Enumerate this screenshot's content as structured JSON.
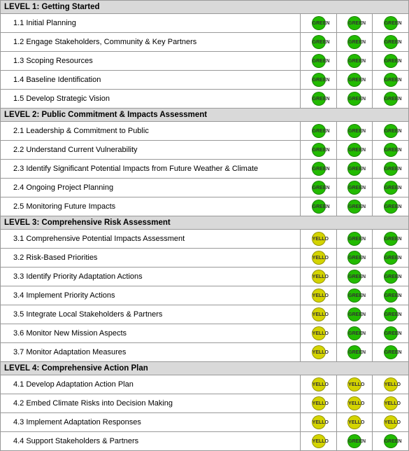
{
  "levels": [
    {
      "id": "level1",
      "header": "LEVEL 1:  Getting Started",
      "items": [
        {
          "id": "1.1",
          "label": "1.1 Initial Planning",
          "cols": [
            "green",
            "green",
            "green"
          ]
        },
        {
          "id": "1.2",
          "label": "1.2 Engage Stakeholders, Community & Key Partners",
          "cols": [
            "green",
            "green",
            "green"
          ]
        },
        {
          "id": "1.3",
          "label": "1.3 Scoping Resources",
          "cols": [
            "green",
            "green",
            "green"
          ]
        },
        {
          "id": "1.4",
          "label": "1.4 Baseline Identification",
          "cols": [
            "green",
            "green",
            "green"
          ]
        },
        {
          "id": "1.5",
          "label": "1.5 Develop Strategic Vision",
          "cols": [
            "green",
            "green",
            "green"
          ]
        }
      ]
    },
    {
      "id": "level2",
      "header": "LEVEL 2:  Public Commitment & Impacts Assessment",
      "items": [
        {
          "id": "2.1",
          "label": "2.1 Leadership & Commitment to Public",
          "cols": [
            "green",
            "green",
            "green"
          ]
        },
        {
          "id": "2.2",
          "label": "2.2 Understand Current Vulnerability",
          "cols": [
            "green",
            "green",
            "green"
          ]
        },
        {
          "id": "2.3",
          "label": "2.3 Identify Significant Potential Impacts from Future Weather & Climate",
          "cols": [
            "green",
            "green",
            "green"
          ]
        },
        {
          "id": "2.4",
          "label": "2.4 Ongoing Project Planning",
          "cols": [
            "green",
            "green",
            "green"
          ]
        },
        {
          "id": "2.5",
          "label": "2.5 Monitoring Future Impacts",
          "cols": [
            "green",
            "green",
            "green"
          ]
        }
      ]
    },
    {
      "id": "level3",
      "header": "LEVEL 3:  Comprehensive Risk Assessment",
      "items": [
        {
          "id": "3.1",
          "label": "3.1 Comprehensive Potential Impacts Assessment",
          "cols": [
            "yellow",
            "green",
            "green"
          ]
        },
        {
          "id": "3.2",
          "label": "3.2 Risk-Based Priorities",
          "cols": [
            "yellow",
            "green",
            "green"
          ]
        },
        {
          "id": "3.3",
          "label": "3.3 Identify Priority Adaptation Actions",
          "cols": [
            "yellow",
            "green",
            "green"
          ]
        },
        {
          "id": "3.4",
          "label": "3.4 Implement Priority Actions",
          "cols": [
            "yellow",
            "green",
            "green"
          ]
        },
        {
          "id": "3.5",
          "label": "3.5 Integrate Local Stakeholders & Partners",
          "cols": [
            "yellow",
            "green",
            "green"
          ]
        },
        {
          "id": "3.6",
          "label": "3.6 Monitor New Mission Aspects",
          "cols": [
            "yellow",
            "green",
            "green"
          ]
        },
        {
          "id": "3.7",
          "label": "3.7 Monitor Adaptation Measures",
          "cols": [
            "yellow",
            "green",
            "green"
          ]
        }
      ]
    },
    {
      "id": "level4",
      "header": "LEVEL 4:  Comprehensive Action Plan",
      "items": [
        {
          "id": "4.1",
          "label": "4.1 Develop Adaptation Action Plan",
          "cols": [
            "yellow",
            "yellow",
            "yellow"
          ]
        },
        {
          "id": "4.2",
          "label": "4.2 Embed Climate Risks into Decision Making",
          "cols": [
            "yellow",
            "yellow",
            "yellow"
          ]
        },
        {
          "id": "4.3",
          "label": "4.3 Implement Adaptation Responses",
          "cols": [
            "yellow",
            "yellow",
            "yellow"
          ]
        },
        {
          "id": "4.4",
          "label": "4.4 Support Stakeholders & Partners",
          "cols": [
            "yellow",
            "green",
            "green"
          ]
        }
      ]
    }
  ],
  "columns": [
    "",
    "",
    ""
  ],
  "colors": {
    "green": "#22bb00",
    "yellow": "#d4d400",
    "level_header_bg": "#d0d0d0",
    "border": "#999999"
  }
}
